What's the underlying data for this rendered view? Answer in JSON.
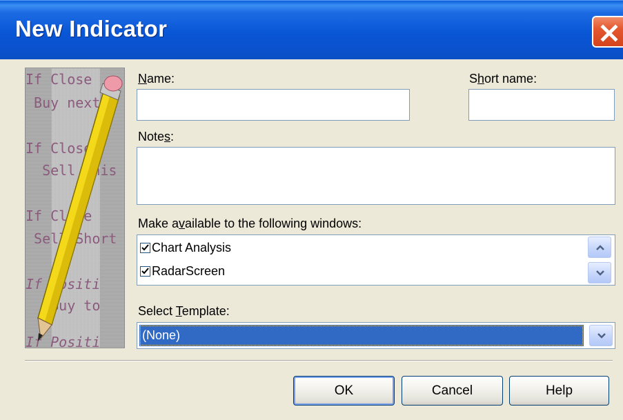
{
  "window": {
    "title": "New Indicator"
  },
  "illustration": {
    "lines": [
      "If Close",
      " Buy next",
      "If Close",
      "  Sell This",
      "If Close",
      " Sell Short",
      "If Positi",
      "   Buy to",
      "If Positi"
    ]
  },
  "form": {
    "name_label": "Name:",
    "name_mnemonic": "N",
    "name_rest": "ame:",
    "name_value": "",
    "short_name_label_pre": "S",
    "short_name_mnemonic": "h",
    "short_name_rest": "ort name:",
    "short_name_value": "",
    "notes_label_pre": "Note",
    "notes_mnemonic": "s",
    "notes_rest": ":",
    "notes_value": "",
    "windows_label_pre": "Make a",
    "windows_mnemonic": "v",
    "windows_rest": "ailable to the following windows:",
    "windows": [
      {
        "label": "Chart Analysis",
        "checked": true
      },
      {
        "label": "RadarScreen",
        "checked": true
      }
    ],
    "template_label_pre": "Select ",
    "template_mnemonic": "T",
    "template_rest": "emplate:",
    "template_value": "(None)"
  },
  "buttons": {
    "ok": "OK",
    "cancel": "Cancel",
    "help": "Help"
  },
  "icons": {
    "close": "close-icon",
    "scroll_up": "scroll-up-icon",
    "scroll_down": "scroll-down-icon",
    "dropdown": "chevron-down-icon",
    "pencil": "pencil-icon"
  },
  "colors": {
    "titlebar": "#0a56d6",
    "selection": "#316ac5",
    "close": "#e4582f"
  }
}
